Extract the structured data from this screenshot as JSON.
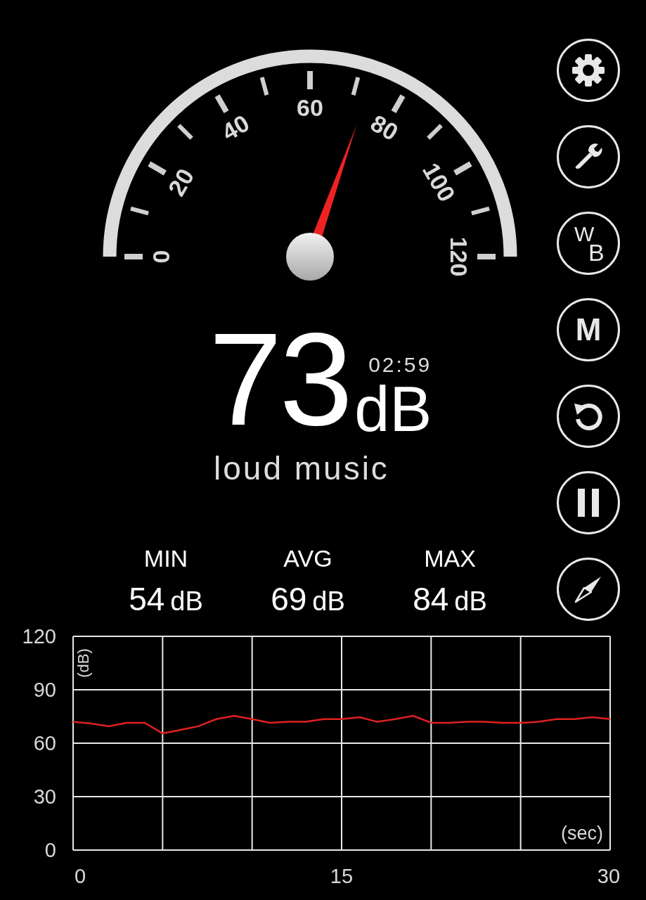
{
  "gauge": {
    "labels": [
      "0",
      "20",
      "40",
      "60",
      "80",
      "100",
      "120"
    ]
  },
  "reading": {
    "value": "73",
    "unit": "dB",
    "time": "02:59",
    "description": "loud music"
  },
  "stats": [
    {
      "label": "MIN",
      "value": "54",
      "unit": "dB"
    },
    {
      "label": "AVG",
      "value": "69",
      "unit": "dB"
    },
    {
      "label": "MAX",
      "value": "84",
      "unit": "dB"
    }
  ],
  "side_buttons": [
    {
      "kind": "settings"
    },
    {
      "kind": "tools"
    },
    {
      "kind": "text",
      "text": "W",
      "subtext": "B"
    },
    {
      "kind": "text",
      "text": "M"
    },
    {
      "kind": "reset"
    },
    {
      "kind": "pause"
    },
    {
      "kind": "compass"
    }
  ],
  "chart": {
    "chart_data": {
      "type": "line",
      "grid": true,
      "xlabel": "(sec)",
      "ylabel": "(dB)",
      "xlim": [
        0,
        30
      ],
      "ylim": [
        0,
        120
      ],
      "xticks": [
        0,
        15,
        30
      ],
      "yticks": [
        0,
        30,
        60,
        90,
        120
      ],
      "x": [
        0,
        1,
        2,
        3,
        4,
        5,
        6,
        7,
        8,
        9,
        10,
        11,
        12,
        13,
        14,
        15,
        16,
        17,
        18,
        19,
        20,
        21,
        22,
        23,
        24,
        25,
        26,
        27,
        28,
        29,
        30
      ],
      "series": [
        {
          "color": "#e02020",
          "values": [
            72,
            71,
            69.5,
            71.5,
            71.5,
            65.5,
            67.5,
            69.5,
            73.5,
            75.4,
            73.5,
            71.5,
            72,
            72,
            73.5,
            73.5,
            74.6,
            72,
            73.5,
            75.4,
            71.5,
            71.5,
            72,
            72,
            71.5,
            71.5,
            72,
            73.5,
            73.5,
            74.6,
            73.5
          ]
        }
      ]
    }
  }
}
